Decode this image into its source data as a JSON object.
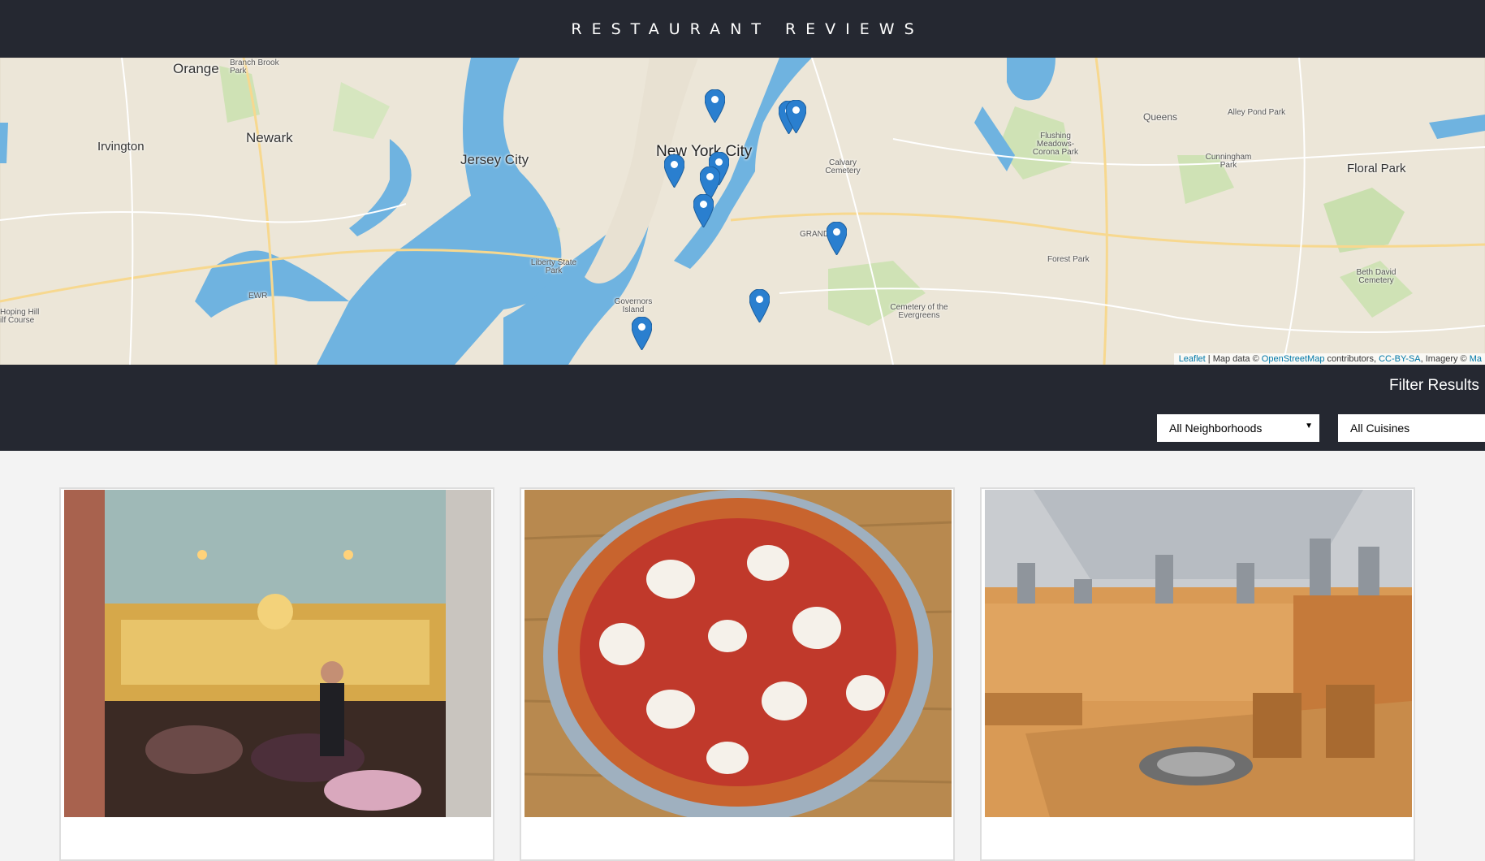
{
  "header": {
    "title": "RESTAURANT REVIEWS"
  },
  "map": {
    "labels": {
      "orange": "Orange",
      "branch_brook": "Branch Brook Park",
      "newark": "Newark",
      "irvington": "Irvington",
      "jersey_city": "Jersey City",
      "nyc": "New York City",
      "liberty": "Liberty State Park",
      "governors": "Governors Island",
      "queens": "Queens",
      "alley_pond": "Alley Pond Park",
      "flushing": "Flushing Meadows-Corona Park",
      "cunningham": "Cunningham Park",
      "calvary": "Calvary Cemetery",
      "floral_park": "Floral Park",
      "forest_park": "Forest Park",
      "beth_david": "Beth David Cemetery",
      "evergreens": "Cemetery of the Evergreens",
      "looping_hill": "Hoping Hill ilf Course",
      "ewr": "EWR",
      "grand": "GRAND"
    },
    "attribution": {
      "leaflet": "Leaflet",
      "sep1": " | Map data © ",
      "osm": "OpenStreetMap",
      "contrib": " contributors, ",
      "license": "CC-BY-SA",
      "imagery": ", Imagery © ",
      "mapbox": "Ma"
    }
  },
  "filters": {
    "title": "Filter Results",
    "neighborhoods": {
      "selected": "All Neighborhoods",
      "arrow": "▼"
    },
    "cuisines": {
      "selected": "All Cuisines"
    }
  },
  "restaurants": [
    {
      "photo": "restaurant-dining-room-photo"
    },
    {
      "photo": "pizza-photo"
    },
    {
      "photo": "korean-bbq-interior-photo"
    }
  ],
  "colors": {
    "header_bg": "#252831",
    "page_bg": "#f3f3f3",
    "water": "#6fb3e0",
    "marker": "#2a7fcf"
  }
}
